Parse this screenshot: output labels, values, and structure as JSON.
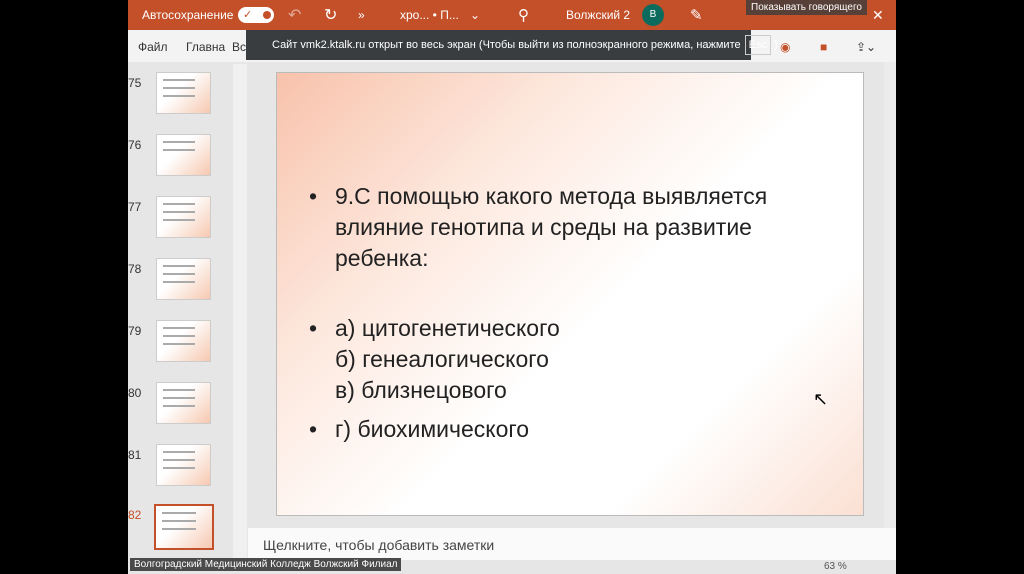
{
  "titlebar": {
    "autosave": "Автосохранение",
    "toggle": "✓",
    "file": "хро... • П...",
    "user": "Волжский 2",
    "avatar": "В",
    "speaker": "Показывать говорящего"
  },
  "ribbon": {
    "tabs": [
      "Файл",
      "Главна",
      "Вставка"
    ]
  },
  "banner": {
    "text": "Сайт vmk2.ktalk.ru открыт во весь экран (Чтобы выйти из полноэкранного режима, нажмите",
    "key": "Esc",
    "close": ")"
  },
  "slides": [
    "75",
    "76",
    "77",
    "78",
    "79",
    "80",
    "81",
    "82"
  ],
  "slide": {
    "question": [
      "9.С помощью какого метода выявляется",
      "влияние генотипа и среды на развитие",
      "ребенка:"
    ],
    "answers": [
      "а) цитогенетического",
      "б) генеалогического",
      "в) близнецового"
    ],
    "last": "г) биохимического"
  },
  "notes": "Щелкните, чтобы добавить заметки",
  "status": {
    "caption": "Волгоградский Медицинский Колледж Волжский Филиал",
    "zoom": "63 %"
  }
}
